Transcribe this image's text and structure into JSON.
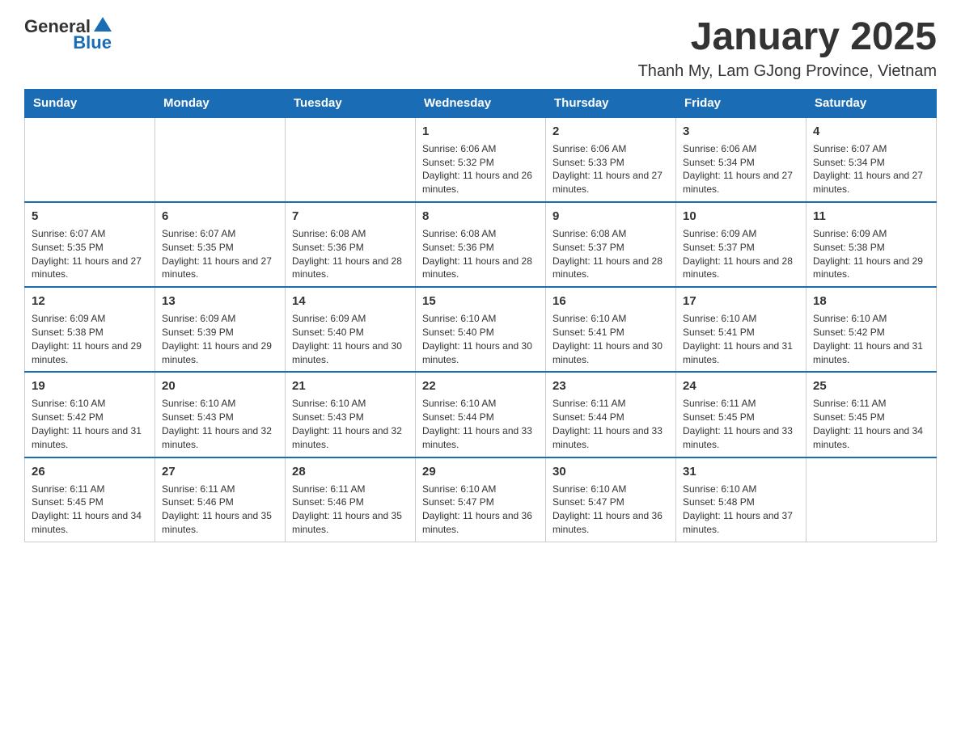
{
  "logo": {
    "text_general": "General",
    "text_blue": "Blue"
  },
  "title": "January 2025",
  "subtitle": "Thanh My, Lam GJong Province, Vietnam",
  "days_of_week": [
    "Sunday",
    "Monday",
    "Tuesday",
    "Wednesday",
    "Thursday",
    "Friday",
    "Saturday"
  ],
  "weeks": [
    [
      {
        "day": "",
        "info": ""
      },
      {
        "day": "",
        "info": ""
      },
      {
        "day": "",
        "info": ""
      },
      {
        "day": "1",
        "info": "Sunrise: 6:06 AM\nSunset: 5:32 PM\nDaylight: 11 hours and 26 minutes."
      },
      {
        "day": "2",
        "info": "Sunrise: 6:06 AM\nSunset: 5:33 PM\nDaylight: 11 hours and 27 minutes."
      },
      {
        "day": "3",
        "info": "Sunrise: 6:06 AM\nSunset: 5:34 PM\nDaylight: 11 hours and 27 minutes."
      },
      {
        "day": "4",
        "info": "Sunrise: 6:07 AM\nSunset: 5:34 PM\nDaylight: 11 hours and 27 minutes."
      }
    ],
    [
      {
        "day": "5",
        "info": "Sunrise: 6:07 AM\nSunset: 5:35 PM\nDaylight: 11 hours and 27 minutes."
      },
      {
        "day": "6",
        "info": "Sunrise: 6:07 AM\nSunset: 5:35 PM\nDaylight: 11 hours and 27 minutes."
      },
      {
        "day": "7",
        "info": "Sunrise: 6:08 AM\nSunset: 5:36 PM\nDaylight: 11 hours and 28 minutes."
      },
      {
        "day": "8",
        "info": "Sunrise: 6:08 AM\nSunset: 5:36 PM\nDaylight: 11 hours and 28 minutes."
      },
      {
        "day": "9",
        "info": "Sunrise: 6:08 AM\nSunset: 5:37 PM\nDaylight: 11 hours and 28 minutes."
      },
      {
        "day": "10",
        "info": "Sunrise: 6:09 AM\nSunset: 5:37 PM\nDaylight: 11 hours and 28 minutes."
      },
      {
        "day": "11",
        "info": "Sunrise: 6:09 AM\nSunset: 5:38 PM\nDaylight: 11 hours and 29 minutes."
      }
    ],
    [
      {
        "day": "12",
        "info": "Sunrise: 6:09 AM\nSunset: 5:38 PM\nDaylight: 11 hours and 29 minutes."
      },
      {
        "day": "13",
        "info": "Sunrise: 6:09 AM\nSunset: 5:39 PM\nDaylight: 11 hours and 29 minutes."
      },
      {
        "day": "14",
        "info": "Sunrise: 6:09 AM\nSunset: 5:40 PM\nDaylight: 11 hours and 30 minutes."
      },
      {
        "day": "15",
        "info": "Sunrise: 6:10 AM\nSunset: 5:40 PM\nDaylight: 11 hours and 30 minutes."
      },
      {
        "day": "16",
        "info": "Sunrise: 6:10 AM\nSunset: 5:41 PM\nDaylight: 11 hours and 30 minutes."
      },
      {
        "day": "17",
        "info": "Sunrise: 6:10 AM\nSunset: 5:41 PM\nDaylight: 11 hours and 31 minutes."
      },
      {
        "day": "18",
        "info": "Sunrise: 6:10 AM\nSunset: 5:42 PM\nDaylight: 11 hours and 31 minutes."
      }
    ],
    [
      {
        "day": "19",
        "info": "Sunrise: 6:10 AM\nSunset: 5:42 PM\nDaylight: 11 hours and 31 minutes."
      },
      {
        "day": "20",
        "info": "Sunrise: 6:10 AM\nSunset: 5:43 PM\nDaylight: 11 hours and 32 minutes."
      },
      {
        "day": "21",
        "info": "Sunrise: 6:10 AM\nSunset: 5:43 PM\nDaylight: 11 hours and 32 minutes."
      },
      {
        "day": "22",
        "info": "Sunrise: 6:10 AM\nSunset: 5:44 PM\nDaylight: 11 hours and 33 minutes."
      },
      {
        "day": "23",
        "info": "Sunrise: 6:11 AM\nSunset: 5:44 PM\nDaylight: 11 hours and 33 minutes."
      },
      {
        "day": "24",
        "info": "Sunrise: 6:11 AM\nSunset: 5:45 PM\nDaylight: 11 hours and 33 minutes."
      },
      {
        "day": "25",
        "info": "Sunrise: 6:11 AM\nSunset: 5:45 PM\nDaylight: 11 hours and 34 minutes."
      }
    ],
    [
      {
        "day": "26",
        "info": "Sunrise: 6:11 AM\nSunset: 5:45 PM\nDaylight: 11 hours and 34 minutes."
      },
      {
        "day": "27",
        "info": "Sunrise: 6:11 AM\nSunset: 5:46 PM\nDaylight: 11 hours and 35 minutes."
      },
      {
        "day": "28",
        "info": "Sunrise: 6:11 AM\nSunset: 5:46 PM\nDaylight: 11 hours and 35 minutes."
      },
      {
        "day": "29",
        "info": "Sunrise: 6:10 AM\nSunset: 5:47 PM\nDaylight: 11 hours and 36 minutes."
      },
      {
        "day": "30",
        "info": "Sunrise: 6:10 AM\nSunset: 5:47 PM\nDaylight: 11 hours and 36 minutes."
      },
      {
        "day": "31",
        "info": "Sunrise: 6:10 AM\nSunset: 5:48 PM\nDaylight: 11 hours and 37 minutes."
      },
      {
        "day": "",
        "info": ""
      }
    ]
  ]
}
